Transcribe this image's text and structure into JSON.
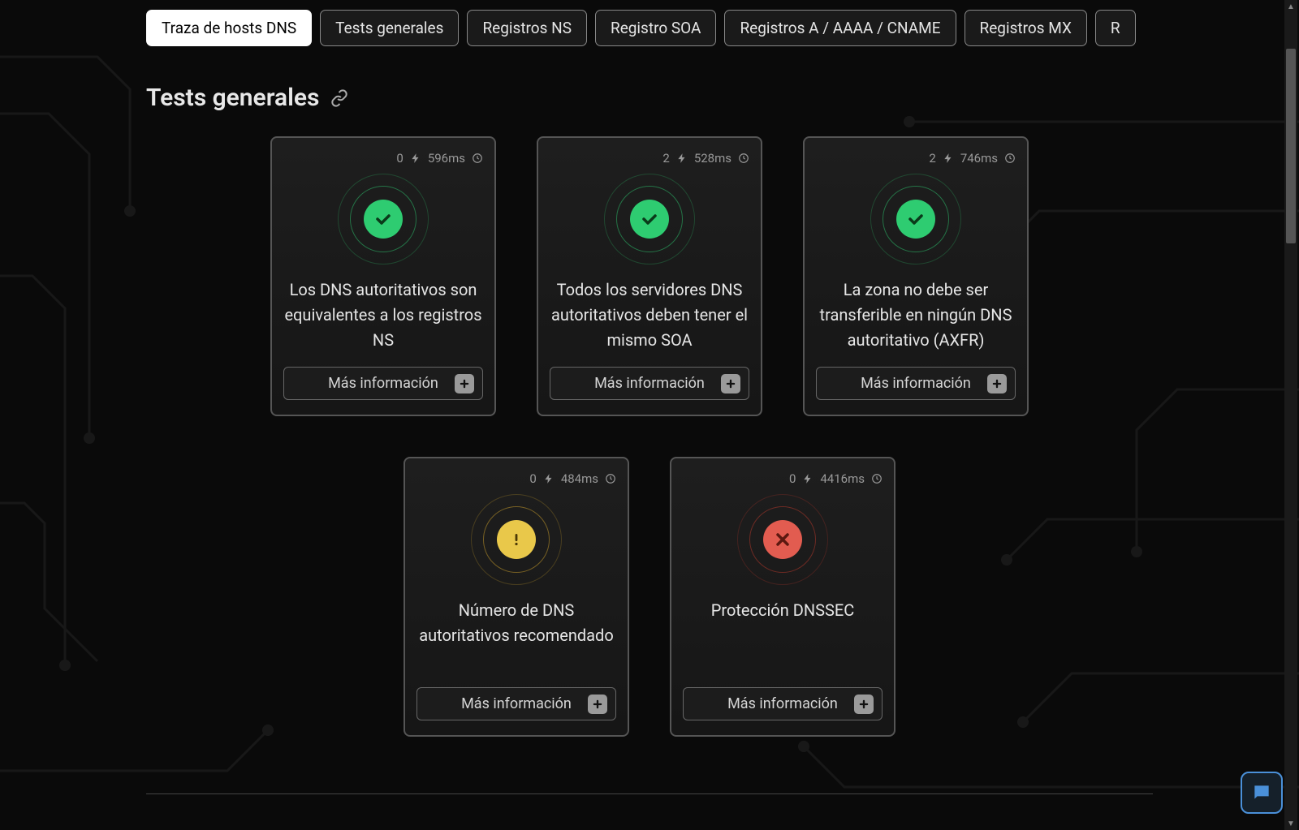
{
  "tabs": [
    {
      "label": "Traza de hosts DNS",
      "active": true
    },
    {
      "label": "Tests generales",
      "active": false
    },
    {
      "label": "Registros NS",
      "active": false
    },
    {
      "label": "Registro SOA",
      "active": false
    },
    {
      "label": "Registros A / AAAA / CNAME",
      "active": false
    },
    {
      "label": "Registros MX",
      "active": false
    },
    {
      "label": "R",
      "active": false
    }
  ],
  "section": {
    "title": "Tests generales"
  },
  "cards": [
    {
      "count": "0",
      "time": "596ms",
      "status": "ok",
      "title": "Los DNS autoritativos son equivalentes a los registros NS",
      "more_label": "Más información"
    },
    {
      "count": "2",
      "time": "528ms",
      "status": "ok",
      "title": "Todos los servidores DNS autoritativos deben tener el mismo SOA",
      "more_label": "Más información"
    },
    {
      "count": "2",
      "time": "746ms",
      "status": "ok",
      "title": "La zona no debe ser transferible en ningún DNS autoritativo (AXFR)",
      "more_label": "Más información"
    },
    {
      "count": "0",
      "time": "484ms",
      "status": "warn",
      "title": "Número de DNS autoritativos recomendado",
      "more_label": "Más información"
    },
    {
      "count": "0",
      "time": "4416ms",
      "status": "err",
      "title": "Protección DNSSEC",
      "more_label": "Más información"
    }
  ]
}
